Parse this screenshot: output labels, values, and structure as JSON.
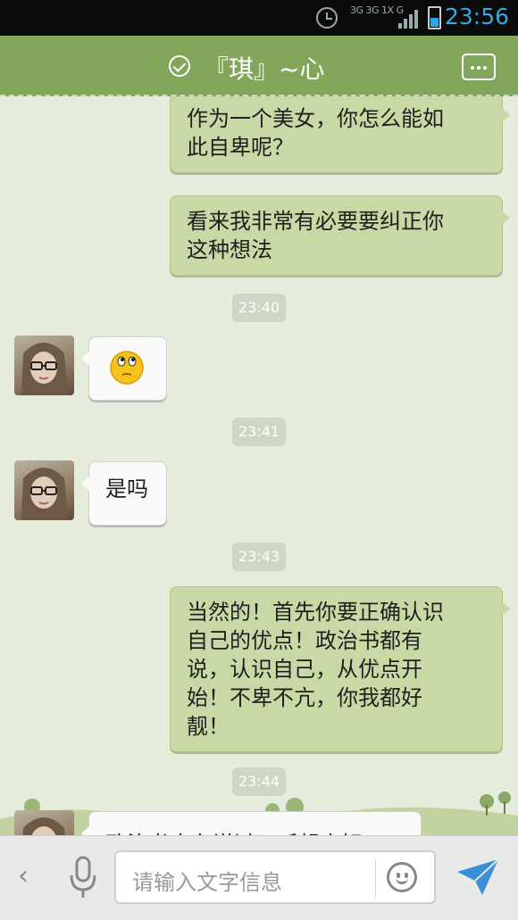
{
  "status_bar": {
    "network": "3G 3G 1X G",
    "time": "23:56"
  },
  "header": {
    "title": "『琪』~心",
    "icons": [
      "check-icon",
      "more-menu-icon"
    ]
  },
  "messages": [
    {
      "side": "out",
      "text_lines": [
        "作为一个美女，你怎么能如",
        "此自卑呢？"
      ]
    },
    {
      "side": "out",
      "text_lines": [
        "看来我非常有必要要纠正你",
        "这种想法"
      ]
    },
    {
      "type": "time",
      "text": "23:40"
    },
    {
      "side": "in",
      "content": "smiley-emoji"
    },
    {
      "type": "time",
      "text": "23:41"
    },
    {
      "side": "in",
      "text_lines": [
        "是吗"
      ]
    },
    {
      "type": "time",
      "text": "23:43"
    },
    {
      "side": "out",
      "text_lines": [
        "当然的！首先你要正确认识",
        "自己的优点！政治书都有",
        "说，认识自己，从优点开",
        "始！不卑不亢，你我都好",
        "靓！"
      ]
    },
    {
      "type": "time",
      "text": "23:44"
    },
    {
      "side": "in",
      "text_lines": [
        "政治书真有说过？听起来好"
      ],
      "partially_visible": true
    }
  ],
  "input_bar": {
    "placeholder": "请输入文字信息",
    "icons": [
      "back-icon",
      "mic-icon",
      "emoji-icon",
      "send-icon"
    ]
  },
  "colors": {
    "header": "#82a65a",
    "bubble_out": "#c9d9a5",
    "bubble_in": "#fafafa",
    "status_time": "#38a8e0"
  }
}
